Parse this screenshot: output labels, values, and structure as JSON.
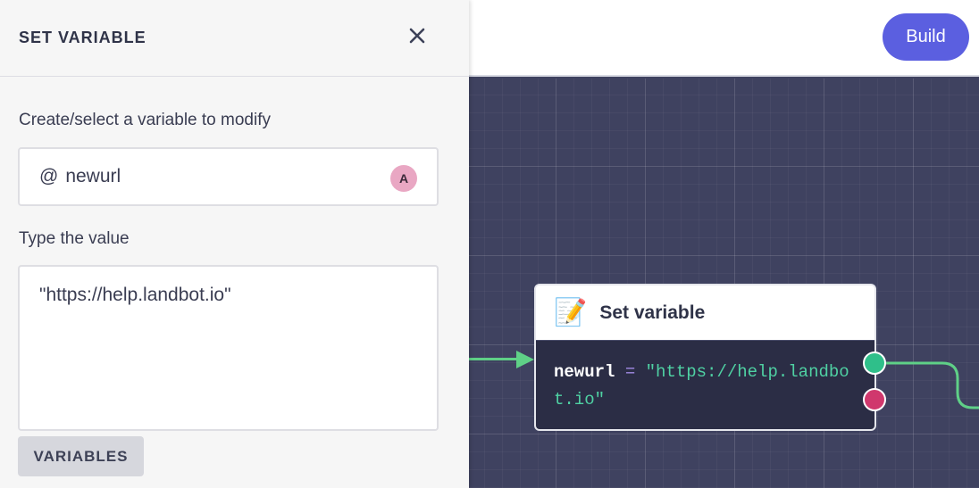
{
  "topbar": {
    "build_label": "Build"
  },
  "panel": {
    "title": "SET VARIABLE",
    "close_icon": "close-icon",
    "variable_label": "Create/select a variable to modify",
    "variable_prefix": "@",
    "variable_value": "newurl",
    "variable_badge": "A",
    "value_label": "Type the value",
    "value_text": "\"https://help.landbot.io\"",
    "variables_button": "VARIABLES"
  },
  "node": {
    "emoji": "📝",
    "title": "Set variable",
    "var_name": "newurl",
    "operator": "=",
    "value": "\"https://help.landbot.io\""
  },
  "colors": {
    "accent": "#5b5fe0",
    "canvas": "#3f4260",
    "wire": "#5fd087",
    "port_success": "#2fbf8a",
    "port_fail": "#d0386d"
  }
}
